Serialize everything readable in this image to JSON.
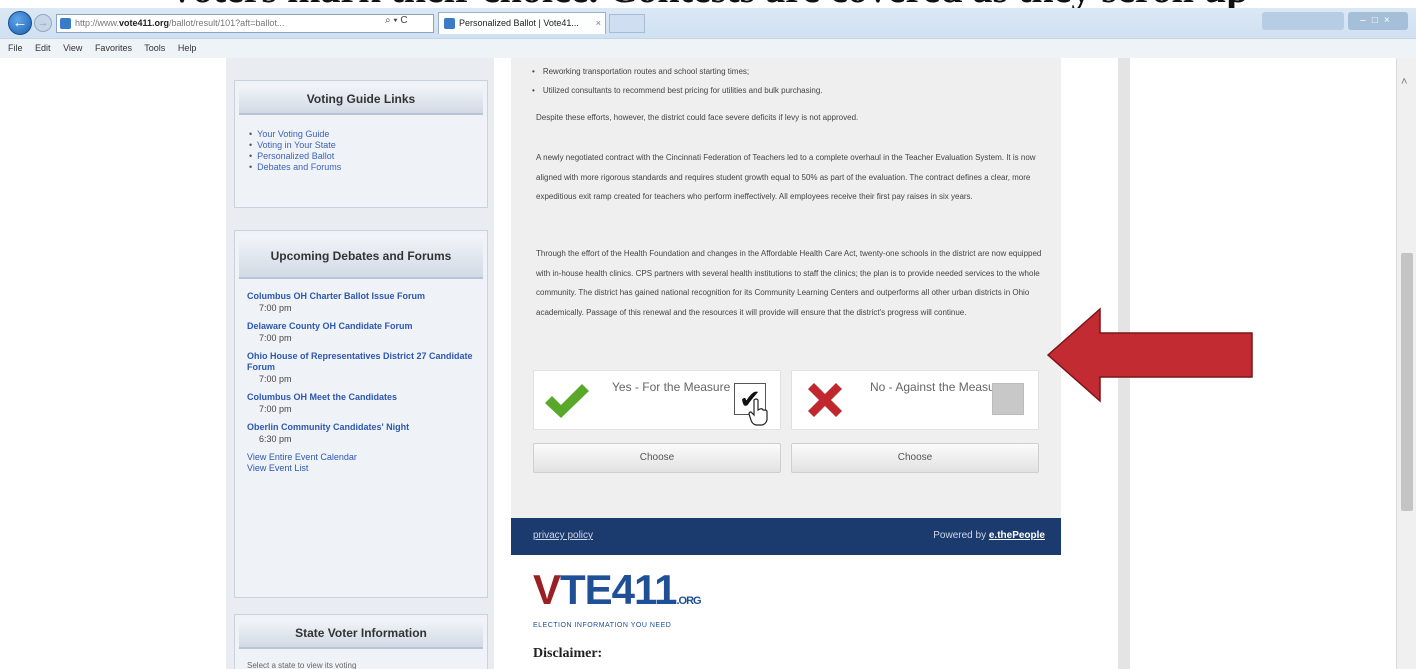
{
  "browser": {
    "address_prefix": "http://www.",
    "address_domain": "vote411.org",
    "address_rest": "/ballot/result/101?aft=ballot...",
    "addr_actions": "⌕ ▾ C",
    "tab_title": "Personalized Ballot | Vote41...",
    "tab_close": "×",
    "back_icon": "←",
    "forward_icon": "→",
    "window_controls": "–□×",
    "scroll_up": "˄",
    "menu": [
      "File",
      "Edit",
      "View",
      "Favorites",
      "Tools",
      "Help"
    ]
  },
  "slide": {
    "heading": "Voters mark their choice. Contests are covered as they scroll up"
  },
  "sidebar": {
    "guide_title": "Voting Guide Links",
    "guide_links": [
      "Your Voting Guide",
      "Voting in Your State",
      "Personalized Ballot",
      "Debates and Forums"
    ],
    "debates_title": "Upcoming Debates and Forums",
    "events": [
      {
        "title": "Columbus OH Charter Ballot Issue Forum",
        "time": "7:00 pm"
      },
      {
        "title": "Delaware County OH Candidate Forum",
        "time": "7:00 pm"
      },
      {
        "title": "Ohio House of Representatives District 27 Candidate Forum",
        "time": "7:00 pm"
      },
      {
        "title": "Columbus OH Meet the Candidates",
        "time": "7:00 pm"
      },
      {
        "title": "Oberlin Community Candidates' Night",
        "time": "6:30 pm"
      }
    ],
    "calendar_link": "View Entire Event Calendar",
    "list_link": "View Event List",
    "state_title": "State Voter Information",
    "state_text": "Select a state to view its voting"
  },
  "article": {
    "bullets": [
      "Reworking transportation routes and school starting times;",
      "Utilized consultants to recommend best pricing for utilities and bulk purchasing."
    ],
    "para1": "Despite these efforts, however, the district could face severe deficits if levy is not approved.",
    "para2": "A newly negotiated contract with the Cincinnati Federation of Teachers led to a complete overhaul in the Teacher Evaluation System. It is now aligned with more rigorous standards and requires student growth equal to 50% as part of the evaluation. The contract defines a clear, more expeditious exit ramp created for teachers who perform ineffectively. All employees receive their first pay raises in six years.",
    "para3": "Through the effort of the Health Foundation and changes in the Affordable Health Care Act, twenty-one schools in the district are now equipped with in-house health clinics. CPS partners with several health institutions to staff the clinics; the plan is to provide needed services to the whole community. The district has gained national recognition for its Community Learning Centers and outperforms all other urban districts in Ohio academically. Passage of this renewal and the resources it will provide will ensure that the district's progress will continue."
  },
  "vote": {
    "yes_label": "Yes - For the Measure",
    "no_label": "No - Against the Measure",
    "yes_checked_mark": "✔",
    "choose_label": "Choose"
  },
  "footer": {
    "privacy": "privacy policy",
    "powered_by": "Powered by",
    "powered_brand": "e.thePeople"
  },
  "logo": {
    "v": "V",
    "main": "TE411",
    "org": ".ORG",
    "tagline": "ELECTION INFORMATION YOU NEED"
  },
  "disclaimer": "Disclaimer:",
  "colors": {
    "footer_bar": "#1b3a6e",
    "link": "#2d58b0",
    "check_green": "#5aa82a",
    "x_red": "#c0282d",
    "arrow_red": "#c32b33"
  }
}
